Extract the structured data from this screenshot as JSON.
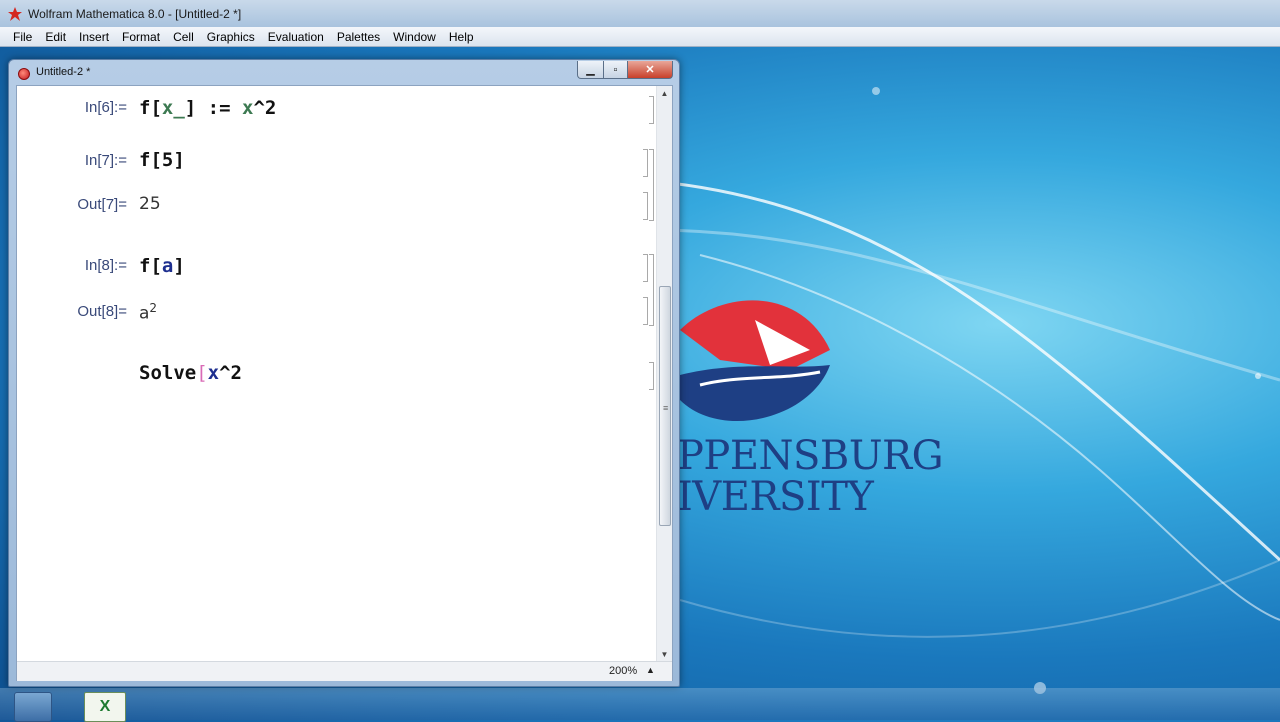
{
  "app": {
    "title": "Wolfram Mathematica 8.0 - [Untitled-2 *]"
  },
  "menu": [
    "File",
    "Edit",
    "Insert",
    "Format",
    "Cell",
    "Graphics",
    "Evaluation",
    "Palettes",
    "Window",
    "Help"
  ],
  "notebook": {
    "title": "Untitled-2 *",
    "zoom": "200%",
    "cells": {
      "in6_label": "In[6]:=",
      "in6_parts": [
        "f[",
        "x_",
        "] := ",
        "x",
        "^2"
      ],
      "in7_label": "In[7]:=",
      "in7_text": "f[5]",
      "out7_label": "Out[7]=",
      "out7_text": "25",
      "in8_label": "In[8]:=",
      "in8_parts": [
        "f[",
        "a",
        "]"
      ],
      "out8_label": "Out[8]=",
      "out8_base": "a",
      "out8_exp": "2",
      "in9_parts": [
        "Solve",
        "[",
        "x",
        "^2"
      ]
    }
  },
  "desktop": {
    "logo_line1": "PPENSBURG",
    "logo_line2": "IVERSITY"
  },
  "taskbar": {
    "excel_glyph": "X"
  },
  "colors": {
    "label": "#3a4a7a",
    "var_green": "#3d7a52",
    "var_blue": "#1e2f8f",
    "logo_red": "#e2323b",
    "logo_navy": "#1e3f84"
  }
}
